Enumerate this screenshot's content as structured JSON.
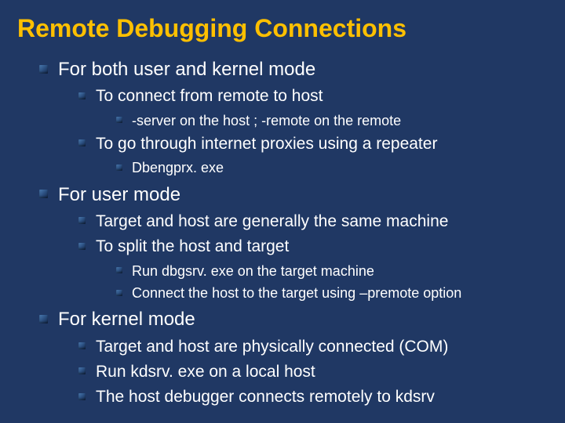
{
  "title": "Remote Debugging Connections",
  "bullets": [
    {
      "text": "For both user and kernel mode",
      "children": [
        {
          "text": "To connect from remote to host",
          "children": [
            {
              "text": "-server on the host ; -remote on the remote"
            }
          ]
        },
        {
          "text": "To go through internet proxies using a repeater",
          "children": [
            {
              "text": "Dbengprx. exe"
            }
          ]
        }
      ]
    },
    {
      "text": "For user mode",
      "children": [
        {
          "text": "Target and host are generally the same machine"
        },
        {
          "text": "To split the host and target",
          "children": [
            {
              "text": "Run dbgsrv. exe on the target machine"
            },
            {
              "text": "Connect the host to the target using –premote option"
            }
          ]
        }
      ]
    },
    {
      "text": "For kernel mode",
      "children": [
        {
          "text": "Target and host are physically connected (COM)"
        },
        {
          "text": "Run kdsrv. exe on a local host"
        },
        {
          "text": "The host debugger connects remotely to kdsrv"
        }
      ]
    }
  ]
}
